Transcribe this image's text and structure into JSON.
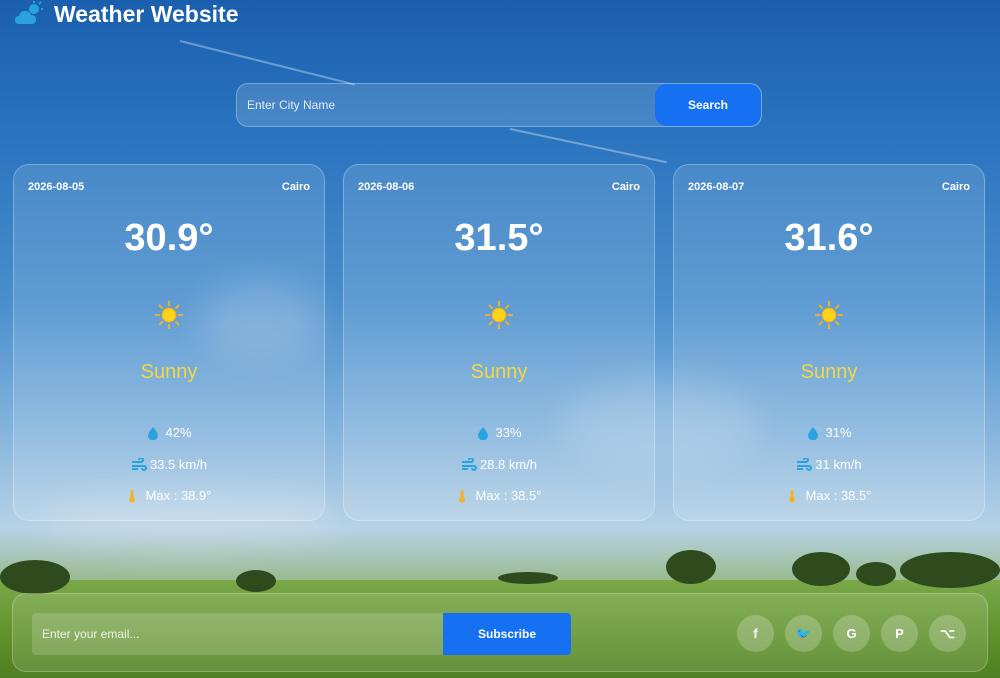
{
  "header": {
    "title": "Weather Website",
    "logo_icon": "cloud-sun-icon"
  },
  "search": {
    "placeholder": "Enter City Name",
    "button_label": "Search"
  },
  "cards": [
    {
      "date": "2026-08-05",
      "city": "Cairo",
      "temperature": "30.9°",
      "condition": "Sunny",
      "humidity": "42%",
      "wind": "33.5 km/h",
      "max": "Max : 38.9°"
    },
    {
      "date": "2026-08-06",
      "city": "Cairo",
      "temperature": "31.5°",
      "condition": "Sunny",
      "humidity": "33%",
      "wind": "28.8 km/h",
      "max": "Max : 38.5°"
    },
    {
      "date": "2026-08-07",
      "city": "Cairo",
      "temperature": "31.6°",
      "condition": "Sunny",
      "humidity": "31%",
      "wind": "31 km/h",
      "max": "Max : 38.5°"
    }
  ],
  "footer": {
    "email_placeholder": "Enter your email...",
    "subscribe_label": "Subscribe",
    "social": [
      {
        "glyph": "f",
        "icon": "facebook-icon"
      },
      {
        "glyph": "🐦",
        "icon": "twitter-icon"
      },
      {
        "glyph": "G",
        "icon": "google-icon"
      },
      {
        "glyph": "P",
        "icon": "pinterest-icon"
      },
      {
        "glyph": "⌥",
        "icon": "github-icon"
      }
    ]
  },
  "colors": {
    "accent": "#1670f2",
    "condition_text": "#f5d742",
    "icon_blue": "#29a3e0",
    "thermo": "#f2b32a"
  }
}
